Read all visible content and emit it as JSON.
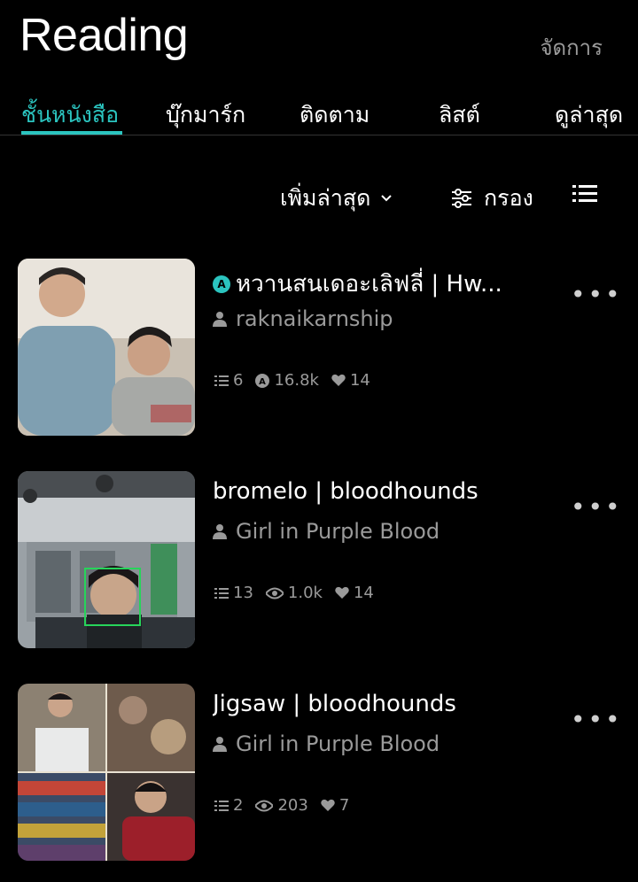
{
  "header": {
    "title": "Reading",
    "manage_label": "จัดการ"
  },
  "tabs": [
    {
      "label": "ชั้นหนังสือ",
      "active": true
    },
    {
      "label": "บุ๊กมาร์ก",
      "active": false
    },
    {
      "label": "ติดตาม",
      "active": false
    },
    {
      "label": "ลิสต์",
      "active": false
    },
    {
      "label": "ดูล่าสุด",
      "active": false
    }
  ],
  "toolbar": {
    "sort_label": "เพิ่มล่าสุด",
    "filter_label": "กรอง"
  },
  "stories": [
    {
      "title": "หวานสนเดอะเลิฟลี่ | Hw...",
      "has_badge": true,
      "author": "raknaikarnship",
      "chapters": "6",
      "views": "16.8k",
      "likes": "14"
    },
    {
      "title": "bromelo | bloodhounds",
      "has_badge": false,
      "author": "Girl in Purple Blood",
      "chapters": "13",
      "views": "1.0k",
      "likes": "14"
    },
    {
      "title": "Jigsaw | bloodhounds",
      "has_badge": false,
      "author": "Girl in Purple Blood",
      "chapters": "2",
      "views": "203",
      "likes": "7"
    }
  ],
  "colors": {
    "accent": "#2bc4bf",
    "muted": "#9a9a9a",
    "background": "#000000"
  }
}
